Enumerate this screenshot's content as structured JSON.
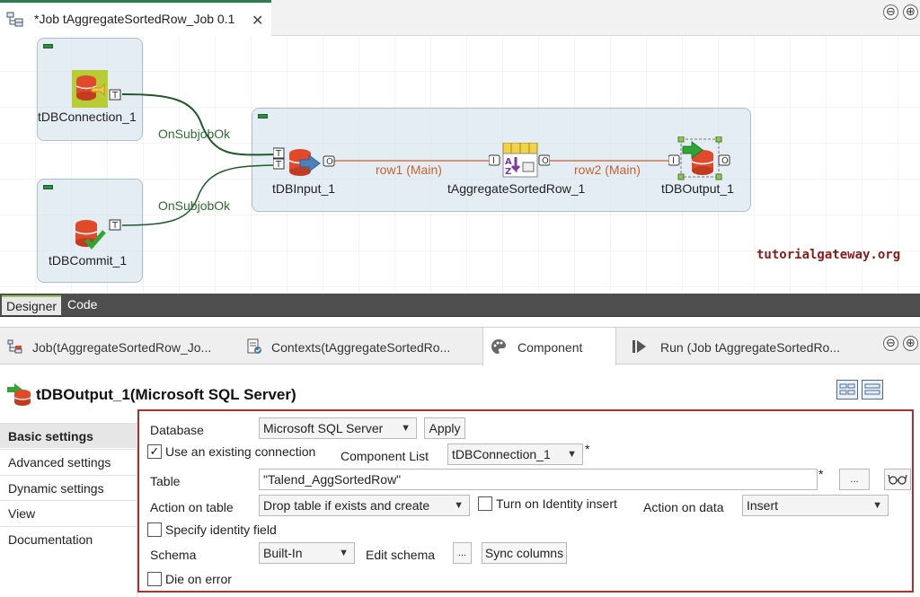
{
  "editor": {
    "job_tab_title": "*Job tAggregateSortedRow_Job 0.1",
    "minimize": "⊖",
    "maximize": "⊕"
  },
  "canvas": {
    "components": {
      "db_connection": "tDBConnection_1",
      "db_commit": "tDBCommit_1",
      "db_input": "tDBInput_1",
      "aggregate": "tAggregateSortedRow_1",
      "db_output": "tDBOutput_1"
    },
    "links": {
      "on_subjob_ok_1": "OnSubjobOk",
      "on_subjob_ok_2": "OnSubjobOk",
      "row1": "row1 (Main)",
      "row2": "row2 (Main)"
    },
    "watermark": "tutorialgateway.org",
    "view_tabs": {
      "designer": "Designer",
      "code": "Code"
    }
  },
  "lower_tabs": [
    {
      "label": "Job(tAggregateSortedRow_Jo..."
    },
    {
      "label": "Contexts(tAggregateSortedRo..."
    },
    {
      "label": "Component"
    },
    {
      "label": "Run (Job tAggregateSortedRo..."
    }
  ],
  "component_title": "tDBOutput_1(Microsoft SQL Server)",
  "sidebar": [
    {
      "label": "Basic settings"
    },
    {
      "label": "Advanced settings"
    },
    {
      "label": "Dynamic settings"
    },
    {
      "label": "View"
    },
    {
      "label": "Documentation"
    }
  ],
  "settings": {
    "database_label": "Database",
    "database_value": "Microsoft SQL Server",
    "apply": "Apply",
    "use_existing_connection": "Use an existing connection",
    "use_existing_connection_checked": true,
    "component_list_label": "Component List",
    "component_list_value": "tDBConnection_1",
    "table_label": "Table",
    "table_value": "\"Talend_AggSortedRow\"",
    "browse": "...",
    "action_on_table_label": "Action on table",
    "action_on_table_value": "Drop table if exists and create",
    "identity_insert": "Turn on Identity insert",
    "action_on_data_label": "Action on data",
    "action_on_data_value": "Insert",
    "specify_identity": "Specify identity field",
    "schema_label": "Schema",
    "schema_value": "Built-In",
    "edit_schema": "Edit schema",
    "edit_schema_btn": "...",
    "sync_columns": "Sync columns",
    "die_on_error": "Die on error",
    "required_mark": "*"
  },
  "colors": {
    "accent_green": "#2a7f4d",
    "panel_border": "#a83232",
    "row_link": "#c96030",
    "trigger_link": "#2f6b2f"
  }
}
